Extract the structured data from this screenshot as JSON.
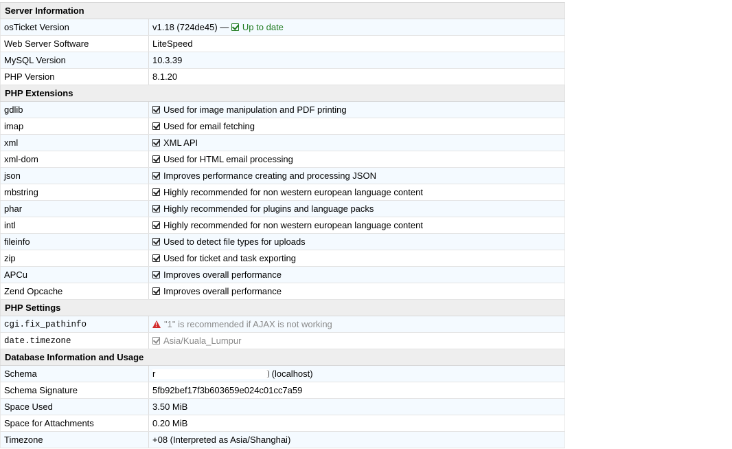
{
  "sections": {
    "server": {
      "title": "Server Information",
      "rows": [
        {
          "label": "osTicket Version",
          "value": "v1.18 (724de45) —",
          "status": "Up to date"
        },
        {
          "label": "Web Server Software",
          "value": "LiteSpeed"
        },
        {
          "label": "MySQL Version",
          "value": "10.3.39"
        },
        {
          "label": "PHP Version",
          "value": "8.1.20"
        }
      ]
    },
    "extensions": {
      "title": "PHP Extensions",
      "rows": [
        {
          "label": "gdlib",
          "value": "Used for image manipulation and PDF printing"
        },
        {
          "label": "imap",
          "value": "Used for email fetching"
        },
        {
          "label": "xml",
          "value": "XML API"
        },
        {
          "label": "xml-dom",
          "value": "Used for HTML email processing"
        },
        {
          "label": "json",
          "value": "Improves performance creating and processing JSON"
        },
        {
          "label": "mbstring",
          "value": "Highly recommended for non western european language content"
        },
        {
          "label": "phar",
          "value": "Highly recommended for plugins and language packs"
        },
        {
          "label": "intl",
          "value": "Highly recommended for non western european language content"
        },
        {
          "label": "fileinfo",
          "value": "Used to detect file types for uploads"
        },
        {
          "label": "zip",
          "value": "Used for ticket and task exporting"
        },
        {
          "label": "APCu",
          "value": "Improves overall performance"
        },
        {
          "label": "Zend Opcache",
          "value": "Improves overall performance"
        }
      ]
    },
    "settings": {
      "title": "PHP Settings",
      "rows": [
        {
          "label": "cgi.fix_pathinfo",
          "value": "\"1\" is recommended if AJAX is not working"
        },
        {
          "label": "date.timezone",
          "value": "Asia/Kuala_Lumpur"
        }
      ]
    },
    "database": {
      "title": "Database Information and Usage",
      "rows": [
        {
          "label": "Schema",
          "value": "(localhost)"
        },
        {
          "label": "Schema Signature",
          "value": "5fb92bef17f3b603659e024c01cc7a59"
        },
        {
          "label": "Space Used",
          "value": "3.50 MiB"
        },
        {
          "label": "Space for Attachments",
          "value": "0.20 MiB"
        },
        {
          "label": "Timezone",
          "value": "+08 (Interpreted as Asia/Shanghai)"
        }
      ]
    }
  },
  "colors": {
    "ok": "#1e7a1e",
    "warning": "#d22a2a",
    "muted": "#8a8a8a",
    "header_bg": "#eeeeee",
    "row_alt_bg": "#f4faff"
  },
  "icons": {
    "ok": "check-square-icon",
    "warning": "warning-triangle-icon"
  }
}
